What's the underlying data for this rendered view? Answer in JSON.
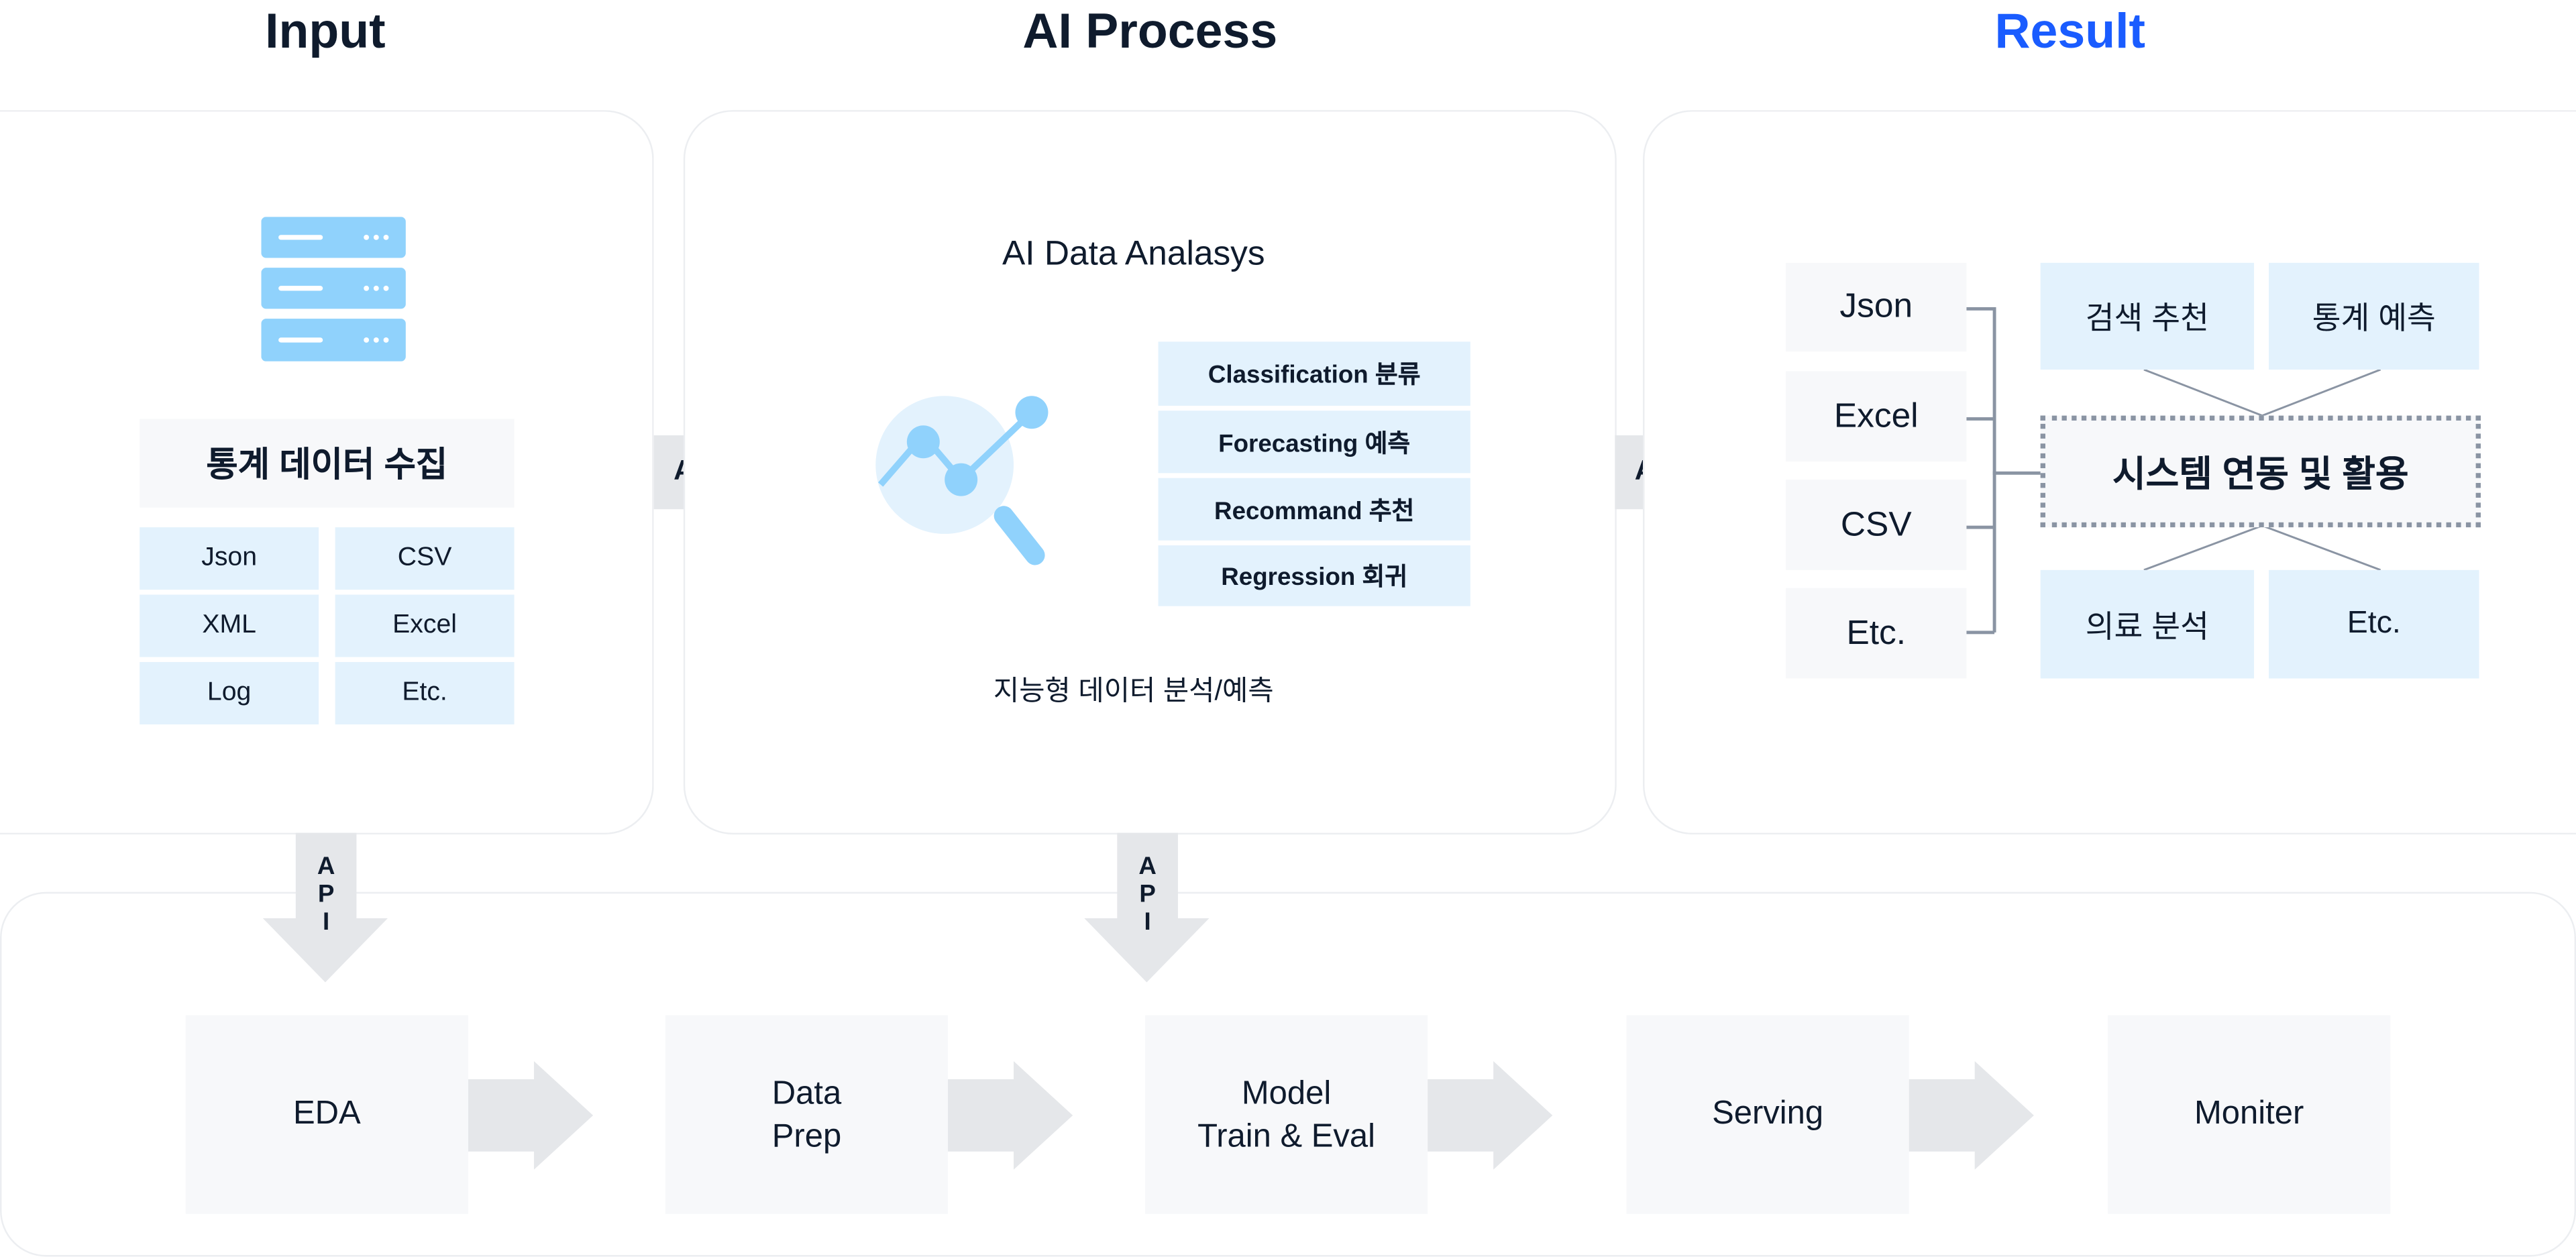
{
  "headers": {
    "input": "Input",
    "process": "AI Process",
    "result": "Result",
    "result_color": "#1a5cff"
  },
  "input": {
    "icon": "server-icon",
    "title": "통계 데이터 수집",
    "formats": [
      "Json",
      "CSV",
      "XML",
      "Excel",
      "Log",
      "Etc."
    ]
  },
  "api_label": "API",
  "api_vertical": [
    "A",
    "P",
    "I"
  ],
  "process": {
    "title": "AI Data Analasys",
    "icon": "chart-magnifier-icon",
    "methods": [
      "Classification 분류",
      "Forecasting 예측",
      "Recommand 추천",
      "Regression 회귀"
    ],
    "caption": "지능형 데이터 분석/예측"
  },
  "result": {
    "formats": [
      "Json",
      "Excel",
      "CSV",
      "Etc."
    ],
    "top": [
      "검색 추천",
      "통계 예측"
    ],
    "center": "시스템 연동 및 활용",
    "bottom": [
      "의료 분석",
      "Etc."
    ]
  },
  "pipeline": [
    {
      "lines": [
        "EDA"
      ]
    },
    {
      "lines": [
        "Data",
        "Prep"
      ]
    },
    {
      "lines": [
        "Model",
        "Train & Eval"
      ]
    },
    {
      "lines": [
        "Serving"
      ]
    },
    {
      "lines": [
        "Moniter"
      ]
    }
  ]
}
